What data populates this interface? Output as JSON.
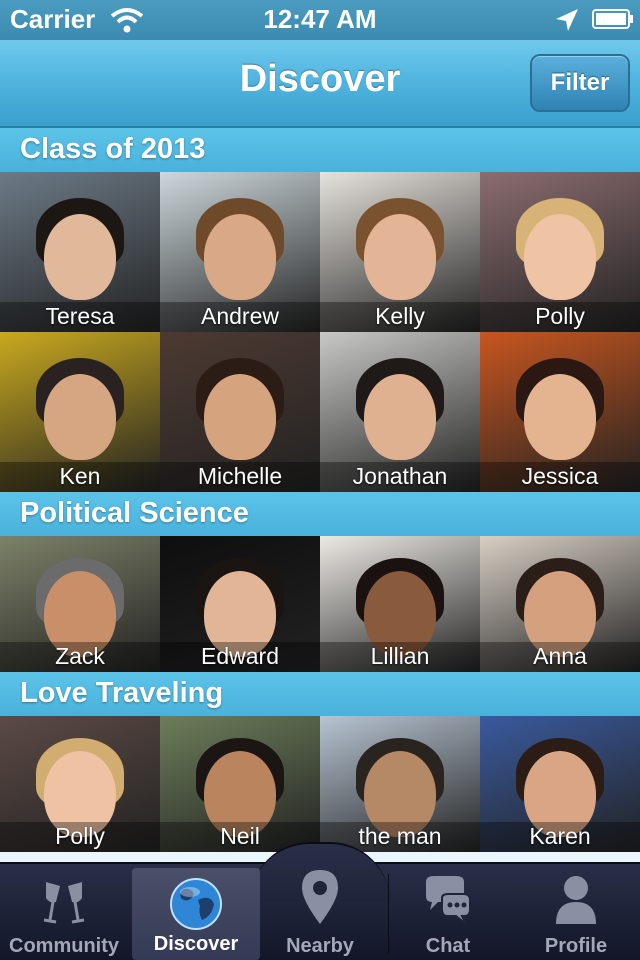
{
  "status_bar": {
    "carrier": "Carrier",
    "time": "12:47 AM"
  },
  "nav": {
    "title": "Discover",
    "filter_label": "Filter"
  },
  "sections": [
    {
      "title": "Class of 2013",
      "people": [
        {
          "name": "Teresa",
          "bg": "#6c7a86",
          "skin": "#e2b89a",
          "hair": "#1d1714"
        },
        {
          "name": "Andrew",
          "bg": "#cdd8dc",
          "skin": "#d9a886",
          "hair": "#6e4a2a"
        },
        {
          "name": "Kelly",
          "bg": "#e6e2dc",
          "skin": "#e3b596",
          "hair": "#7a5230"
        },
        {
          "name": "Polly",
          "bg": "#8c6d70",
          "skin": "#efc4a5",
          "hair": "#d7b378"
        },
        {
          "name": "Ken",
          "bg": "#c9a91f",
          "skin": "#d6a582",
          "hair": "#2a2220"
        },
        {
          "name": "Michelle",
          "bg": "#4d3a32",
          "skin": "#d6a37f",
          "hair": "#2c1c16"
        },
        {
          "name": "Jonathan",
          "bg": "#c8c8c6",
          "skin": "#e0b191",
          "hair": "#1f1a17"
        },
        {
          "name": "Jessica",
          "bg": "#c8561f",
          "skin": "#e4b490",
          "hair": "#2b1812"
        }
      ]
    },
    {
      "title": "Political Science",
      "people": [
        {
          "name": "Zack",
          "bg": "#7d8268",
          "skin": "#c98f69",
          "hair": "#6b6b6b"
        },
        {
          "name": "Edward",
          "bg": "#0e0e0e",
          "skin": "#e2b597",
          "hair": "#1a1412"
        },
        {
          "name": "Lillian",
          "bg": "#ece9e4",
          "skin": "#8a5a3c",
          "hair": "#1a1210"
        },
        {
          "name": "Anna",
          "bg": "#d8cfc4",
          "skin": "#d4a07e",
          "hair": "#2b1d18"
        }
      ]
    },
    {
      "title": "Love Traveling",
      "people": [
        {
          "name": "Polly",
          "bg": "#5c4a45",
          "skin": "#eec2a3",
          "hair": "#d2ad72"
        },
        {
          "name": "Neil",
          "bg": "#6d7e5a",
          "skin": "#b9845e",
          "hair": "#1b1613"
        },
        {
          "name": "the man",
          "bg": "#b7c4d2",
          "skin": "#b58866",
          "hair": "#2a2421"
        },
        {
          "name": "Karen",
          "bg": "#3a5a9e",
          "skin": "#d9a584",
          "hair": "#2b1c15"
        }
      ]
    }
  ],
  "tabs": [
    {
      "label": "Community",
      "icon": "toast-glasses-icon"
    },
    {
      "label": "Discover",
      "icon": "globe-icon"
    },
    {
      "label": "Nearby",
      "icon": "location-pin-icon"
    },
    {
      "label": "Chat",
      "icon": "chat-bubbles-icon"
    },
    {
      "label": "Profile",
      "icon": "person-icon"
    }
  ],
  "active_tab": "Discover"
}
